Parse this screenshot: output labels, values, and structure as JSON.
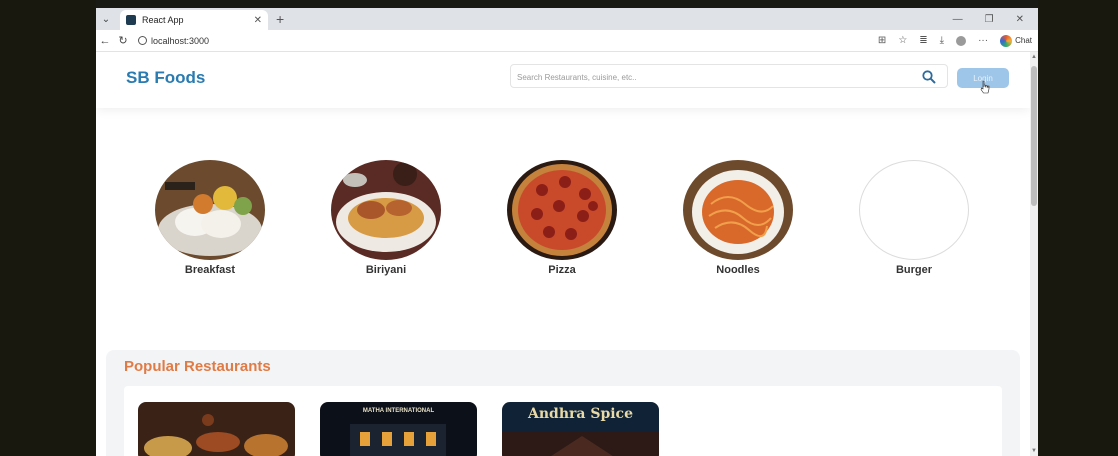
{
  "browser": {
    "tab_title": "React App",
    "url": "localhost:3000",
    "chat_label": "Chat"
  },
  "header": {
    "brand": "SB Foods",
    "search_placeholder": "Search Restaurants, cuisine, etc..",
    "login_label": "Login"
  },
  "categories": [
    {
      "label": "Breakfast"
    },
    {
      "label": "Biriyani"
    },
    {
      "label": "Pizza"
    },
    {
      "label": "Noodles"
    },
    {
      "label": "Burger"
    }
  ],
  "popular": {
    "title": "Popular Restaurants",
    "cards": [
      {
        "sign": ""
      },
      {
        "sign": "MATHA INTERNATIONAL"
      },
      {
        "sign": "Andhra Spice"
      }
    ]
  }
}
